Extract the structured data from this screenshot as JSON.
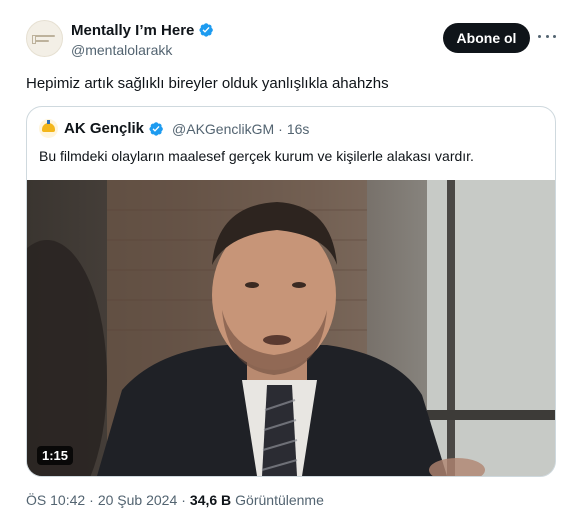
{
  "author": {
    "display_name": "Mentally I’m Here",
    "handle": "@mentalolarakk",
    "avatar_icon": "mentally-logo-avatar"
  },
  "follow_button": {
    "label": "Abone ol",
    "background": "#0f1419"
  },
  "more_icon": "more-dots-icon",
  "tweet": {
    "text": "Hepimiz artık sağlıklı bireyler olduk yanlışlıkla ahahzhs"
  },
  "quote": {
    "name": "AK Gençlik",
    "handle": "@AKGenclikGM",
    "separator": "·",
    "time": "16s",
    "text": "Bu filmdeki olayların maalesef gerçek kurum ve kişilerle alakası vardır.",
    "video": {
      "duration": "1:15"
    }
  },
  "meta": {
    "time": "ÖS 10:42",
    "separator": "·",
    "date": "20 Şub 2024",
    "views_count": "34,6 B",
    "views_label": "Görüntülenme"
  },
  "colors": {
    "verified": "#1d9bf0",
    "secondary_text": "#536471",
    "border": "#cfd9de"
  }
}
